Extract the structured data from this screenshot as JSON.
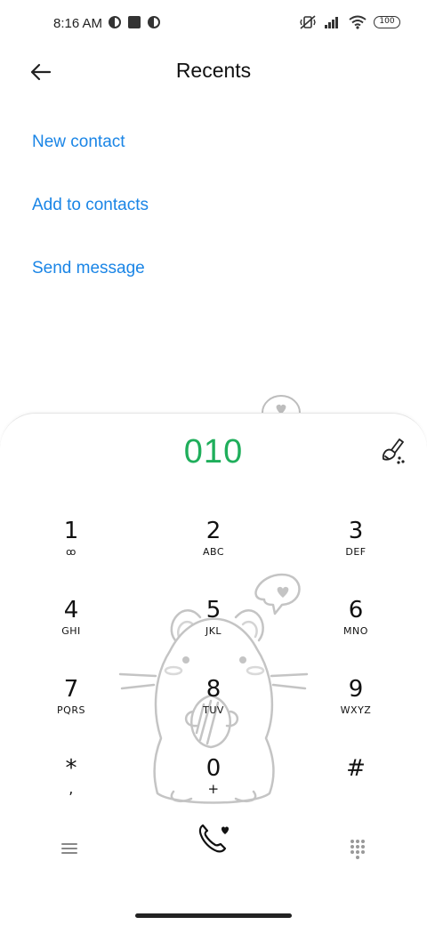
{
  "status_bar": {
    "time": "8:16 AM",
    "battery": "100",
    "icons": [
      "app-icon",
      "stop-icon",
      "app-icon",
      "vibrate-off-icon",
      "signal-icon",
      "wifi-icon",
      "battery-icon"
    ]
  },
  "header": {
    "title": "Recents",
    "back_icon": "arrow-left-icon"
  },
  "actions": {
    "new_contact": "New contact",
    "add_to_contacts": "Add to contacts",
    "send_message": "Send message"
  },
  "dialer": {
    "number": "010",
    "keys": [
      {
        "digit": "1",
        "letters": "ꝏ"
      },
      {
        "digit": "2",
        "letters": "ABC"
      },
      {
        "digit": "3",
        "letters": "DEF"
      },
      {
        "digit": "4",
        "letters": "GHI"
      },
      {
        "digit": "5",
        "letters": "JKL"
      },
      {
        "digit": "6",
        "letters": "MNO"
      },
      {
        "digit": "7",
        "letters": "PQRS"
      },
      {
        "digit": "8",
        "letters": "TUV"
      },
      {
        "digit": "9",
        "letters": "WXYZ"
      },
      {
        "digit": "*",
        "letters": ","
      },
      {
        "digit": "0",
        "letters": "+"
      },
      {
        "digit": "#",
        "letters": ""
      }
    ]
  },
  "colors": {
    "accent_link": "#1a85e6",
    "dialed_number": "#1fae5b",
    "text": "#111111"
  }
}
